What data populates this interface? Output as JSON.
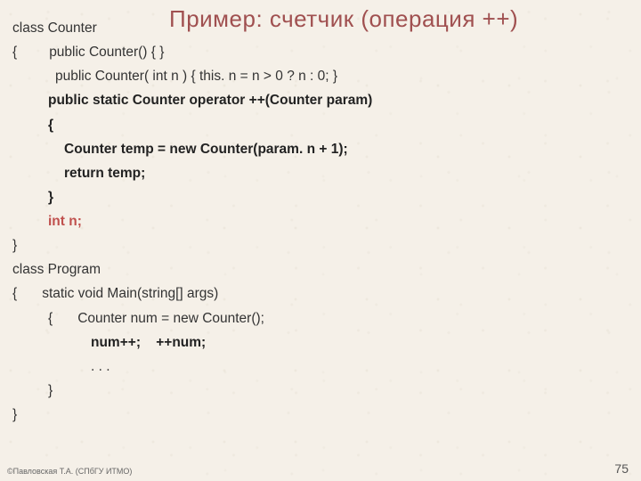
{
  "title": "Пример: счетчик (операция ++)",
  "code": {
    "l1a": "class Counter",
    "l2brace": "{",
    "l2": "public Counter() { }",
    "l3": "public Counter( int n ) { this. n = n > 0 ? n : 0; }",
    "l4a": "public static Counter ",
    "l4b": "operator ++",
    "l4c": "(Counter param)",
    "l5": "{",
    "l6": "Counter temp = new Counter(param. n + 1);",
    "l7": "return temp;",
    "l8": "}",
    "l9": "int n;",
    "l10": "}",
    "l11": "class Program",
    "l12a": "{",
    "l12b": "static void Main(string[] args)",
    "l13a": "{",
    "l13b": "Counter num = new Counter();",
    "l14a": "num++;",
    "l14b": "++num;",
    "l15": ". . .",
    "l16": "}",
    "l17": "}"
  },
  "footer": "©Павловская Т.А. (СПбГУ ИТМО)",
  "page": "75"
}
